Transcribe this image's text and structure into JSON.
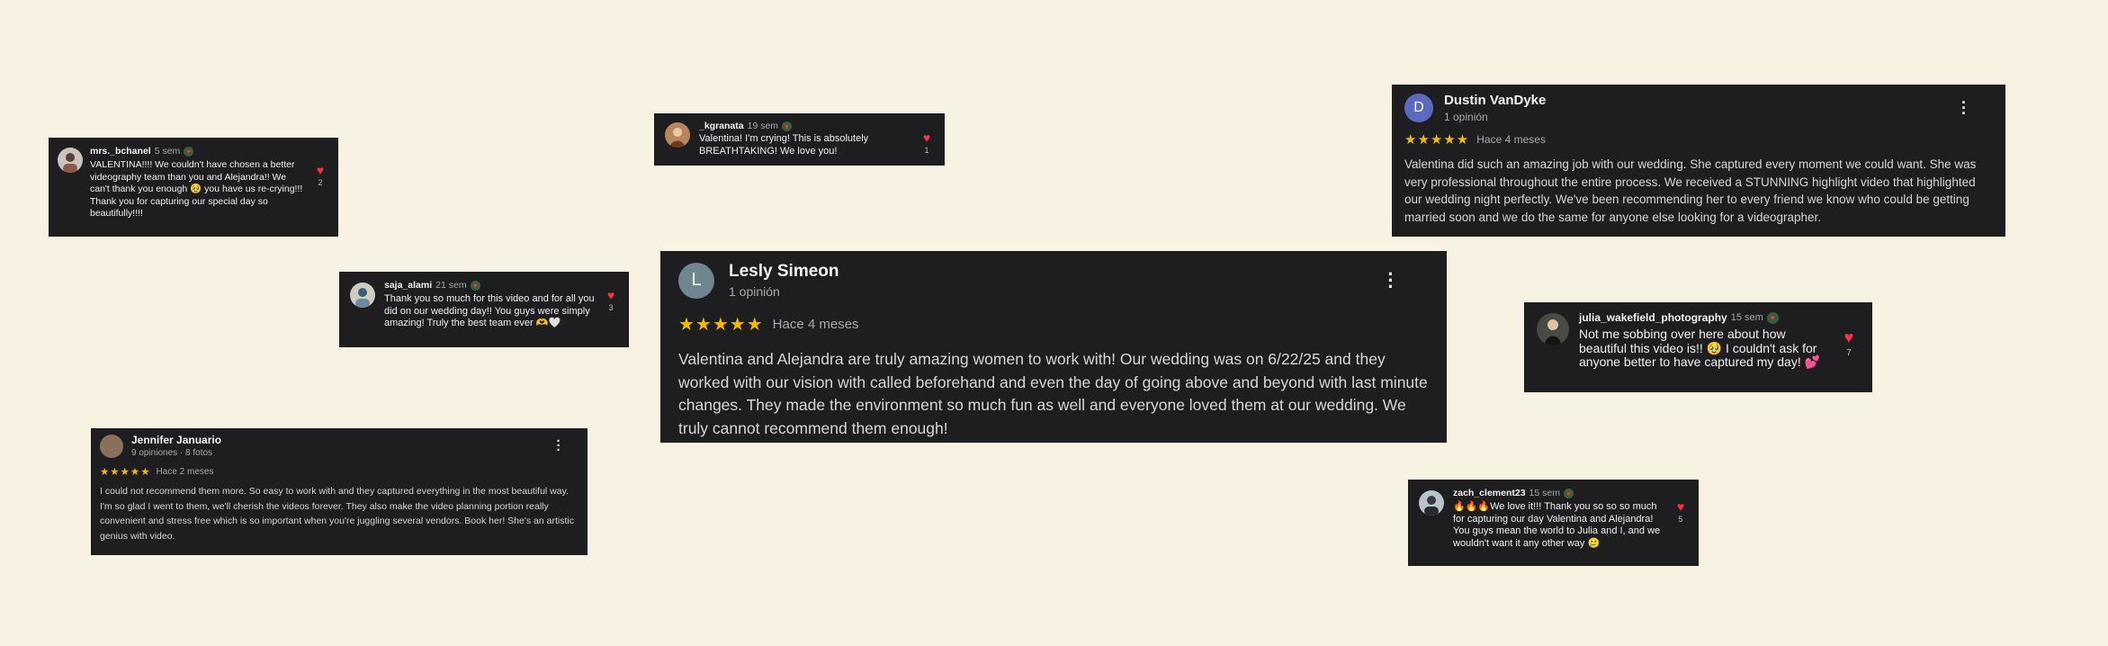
{
  "colors": {
    "background": "#f8f2e2",
    "card": "#1e1e20",
    "heart": "#ff3040",
    "star": "#f5b800"
  },
  "ig_comments": [
    {
      "id": "mrs_bchanel",
      "username": "mrs._bchanel",
      "time": "5 sem",
      "text": "VALENTINA!!!! We couldn't have chosen a better videography team than you and Alejandra!! We can't thank you enough 🥹 you have us re-crying!!! Thank you for capturing our special day so beautifully!!!!",
      "likes": "2",
      "icon": "heart-icon"
    },
    {
      "id": "kgranata",
      "username": "_kgranata",
      "time": "19 sem",
      "text": "Valentina! I'm crying! This is absolutely BREATHTAKING! We love you!",
      "likes": "1",
      "icon": "heart-icon"
    },
    {
      "id": "saja_alami",
      "username": "saja_alami",
      "time": "21 sem",
      "text": "Thank you so much for this video and for all you did on our wedding day!! You guys were simply amazing! Truly the best team ever 🫶🤍",
      "likes": "3",
      "icon": "heart-icon"
    },
    {
      "id": "julia_wakefield",
      "username": "julia_wakefield_photography",
      "time": "15 sem",
      "text": "Not me sobbing over here about how beautiful this video is!! 🥹 I couldn't ask for anyone better to have captured my day! 💕",
      "likes": "7",
      "icon": "heart-icon"
    },
    {
      "id": "zach_clement23",
      "username": "zach_clement23",
      "time": "15 sem",
      "text": "🔥🔥🔥We love it!!! Thank you so so so much for capturing our day Valentina and Alejandra! You guys mean the world to Julia and I, and we wouldn't want it any other way 🥲",
      "likes": "5",
      "icon": "heart-icon"
    }
  ],
  "google_reviews": [
    {
      "id": "lesly",
      "initial": "L",
      "avatar_color": "#6f8590",
      "name": "Lesly Simeon",
      "sub": "1 opinión",
      "stars": "★★★★★",
      "when": "Hace 4 meses",
      "text": "Valentina and Alejandra are truly amazing women to work with! Our wedding was on 6/22/25 and they worked with our vision with called beforehand and even the day of going above and beyond with last minute changes. They made the environment so much fun as well and everyone loved them at our wedding. We truly cannot recommend them enough!",
      "menu_icon": "more-vert-icon"
    },
    {
      "id": "dustin",
      "initial": "D",
      "avatar_color": "#5c6bc0",
      "name": "Dustin VanDyke",
      "sub": "1 opinión",
      "stars": "★★★★★",
      "when": "Hace 4 meses",
      "text": "Valentina did such an amazing job with our wedding. She captured every moment we could want. She was very professional throughout the entire process. We received a STUNNING highlight video that highlighted our wedding night perfectly. We've been recommending her to every friend we know who could be getting married soon and we do the same for anyone else looking for a videographer.",
      "menu_icon": "more-vert-icon"
    },
    {
      "id": "jennifer",
      "initial": "",
      "avatar_color": "#8a6f5c",
      "name": "Jennifer Januario",
      "sub": "9 opiniones · 8 fotos",
      "stars": "★★★★★",
      "when": "Hace 2 meses",
      "text": "I could not recommend them more. So easy to work with and they captured everything in the most beautiful way. I'm so glad I went to them, we'll cherish the videos forever. They also make the video planning portion really convenient and stress free which is so important when you're juggling several vendors. Book her! She's an artistic genius with video.",
      "menu_icon": "more-vert-icon"
    }
  ]
}
